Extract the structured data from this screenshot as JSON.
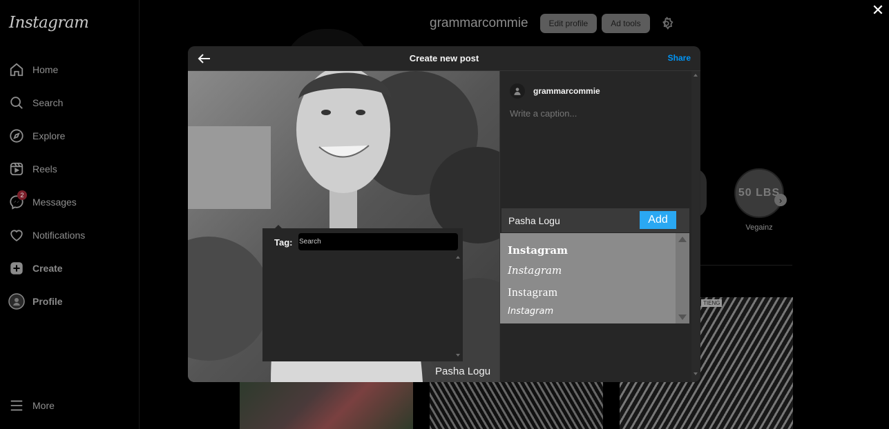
{
  "app": {
    "logo": "Instagram"
  },
  "sidebar": {
    "items": [
      {
        "label": "Home",
        "icon": "home-icon"
      },
      {
        "label": "Search",
        "icon": "search-icon"
      },
      {
        "label": "Explore",
        "icon": "compass-icon"
      },
      {
        "label": "Reels",
        "icon": "reels-icon"
      },
      {
        "label": "Messages",
        "icon": "messenger-icon",
        "badge": "2"
      },
      {
        "label": "Notifications",
        "icon": "heart-icon"
      },
      {
        "label": "Create",
        "icon": "plus-square-icon"
      },
      {
        "label": "Profile",
        "icon": "avatar"
      }
    ],
    "more_label": "More"
  },
  "profile": {
    "username": "grammarcommie",
    "edit_profile_label": "Edit profile",
    "ad_tools_label": "Ad tools"
  },
  "highlights": [
    {
      "label": "Vegainz",
      "cover_text": "50 LBS"
    }
  ],
  "grid": {
    "tile_text": "TIENG"
  },
  "modal": {
    "title": "Create new post",
    "share_label": "Share",
    "photo_label": "Pasha Logu",
    "tag": {
      "label": "Tag:",
      "placeholder": "Search"
    },
    "username": "grammarcommie",
    "caption_placeholder": "Write a caption...",
    "add_input_value": "Pasha Logu",
    "add_label": "Add",
    "font_options": [
      "Instagram",
      "Instagram",
      "Instagram",
      "Instagram"
    ]
  },
  "colors": {
    "accent": "#0095f6",
    "add_button": "#2aa8f2",
    "badge": "#7a1f2a"
  }
}
